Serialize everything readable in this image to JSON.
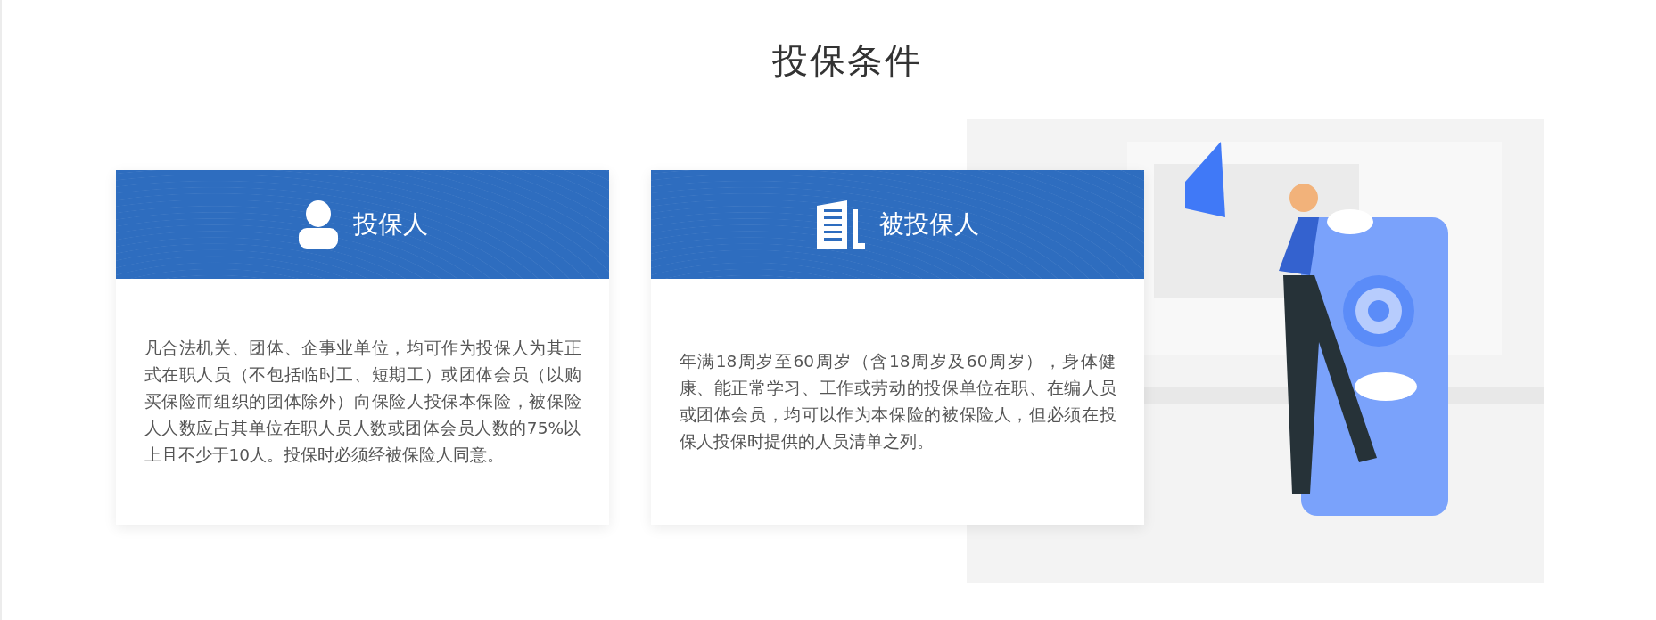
{
  "section_title": "投保条件",
  "cards": [
    {
      "kind": "person",
      "title": "投保人",
      "body": " 凡合法机关、团体、企事业单位，均可作为投保人为其正式在职人员（不包括临时工、短期工）或团体会员（以购买保险而组织的团体除外）向保险人投保本保险，被保险人人数应占其单位在职人员人数或团体会员人数的75%以上且不少于10人。投保时必须经被保险人同意。"
    },
    {
      "kind": "building",
      "title": "被投保人",
      "body": " 年满18周岁至60周岁（含18周岁及60周岁），身体健康、能正常学习、工作或劳动的投保单位在职、在编人员或团体会员，均可以作为本保险的被保险人，但必须在投保人投保时提供的人员清单之列。"
    }
  ]
}
